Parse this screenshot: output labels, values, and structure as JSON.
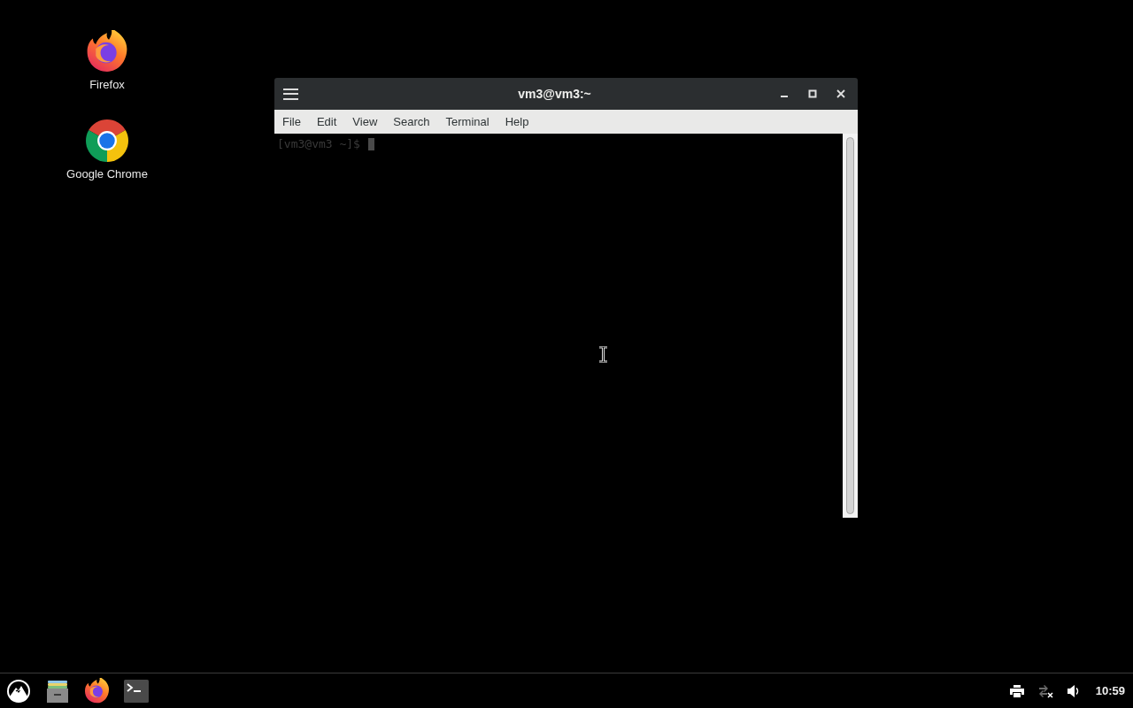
{
  "desktop_icons": [
    {
      "label": "Firefox",
      "kind": "firefox"
    },
    {
      "label": "Google Chrome",
      "kind": "chrome"
    }
  ],
  "window": {
    "title": "vm3@vm3:~",
    "menu": [
      "File",
      "Edit",
      "View",
      "Search",
      "Terminal",
      "Help"
    ],
    "prompt": "[vm3@vm3 ~]$"
  },
  "taskbar": {
    "clock": "10:59"
  }
}
